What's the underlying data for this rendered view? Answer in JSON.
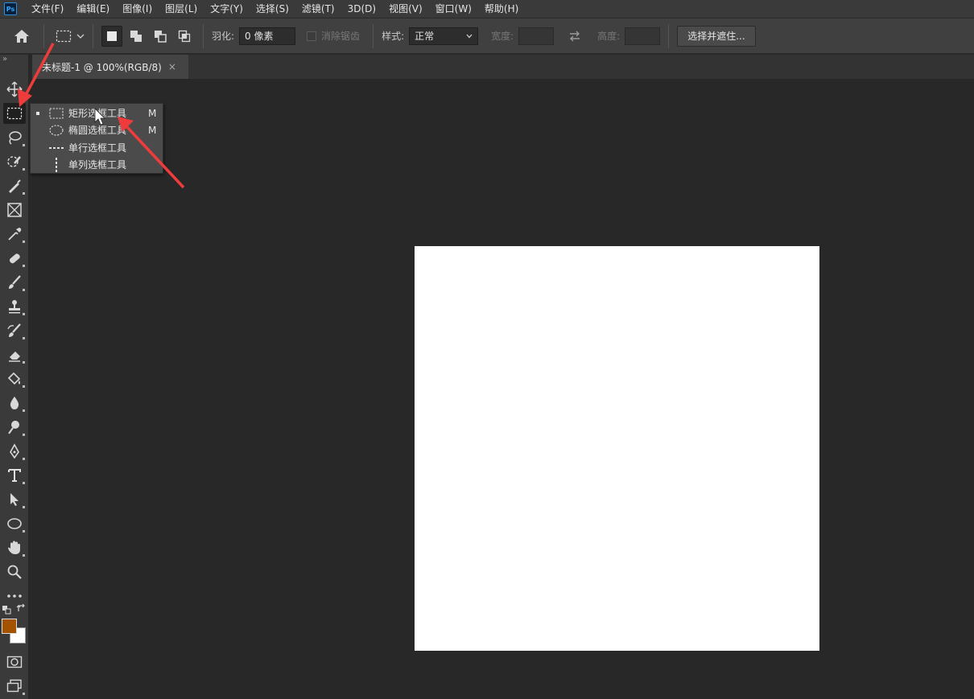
{
  "app": {
    "logo": "Ps"
  },
  "menu": {
    "items": [
      "文件(F)",
      "编辑(E)",
      "图像(I)",
      "图层(L)",
      "文字(Y)",
      "选择(S)",
      "滤镜(T)",
      "3D(D)",
      "视图(V)",
      "窗口(W)",
      "帮助(H)"
    ]
  },
  "options": {
    "feather_label": "羽化:",
    "feather_value": "0 像素",
    "antialias_label": "消除锯齿",
    "style_label": "样式:",
    "style_value": "正常",
    "width_label": "宽度:",
    "height_label": "高度:",
    "select_mask_button": "选择并遮住..."
  },
  "document": {
    "tab_title": "未标题-1 @ 100%(RGB/8)",
    "tab_close": "×",
    "canvas_color": "#ffffff"
  },
  "flyout": {
    "items": [
      {
        "label": "矩形选框工具",
        "shortcut": "M",
        "icon": "rect-marquee-icon",
        "selected": true
      },
      {
        "label": "椭圆选框工具",
        "shortcut": "M",
        "icon": "ellipse-marquee-icon",
        "selected": false
      },
      {
        "label": "单行选框工具",
        "shortcut": "",
        "icon": "single-row-marquee-icon",
        "selected": false
      },
      {
        "label": "单列选框工具",
        "shortcut": "",
        "icon": "single-column-marquee-icon",
        "selected": false
      }
    ]
  },
  "toolbar": {
    "collapse": "»",
    "foreground_color": "#a35200",
    "background_color": "#ffffff"
  },
  "colors": {
    "annotation_arrow": "#ee3b3b",
    "workspace": "#282828",
    "panel": "#3a3a3a"
  }
}
